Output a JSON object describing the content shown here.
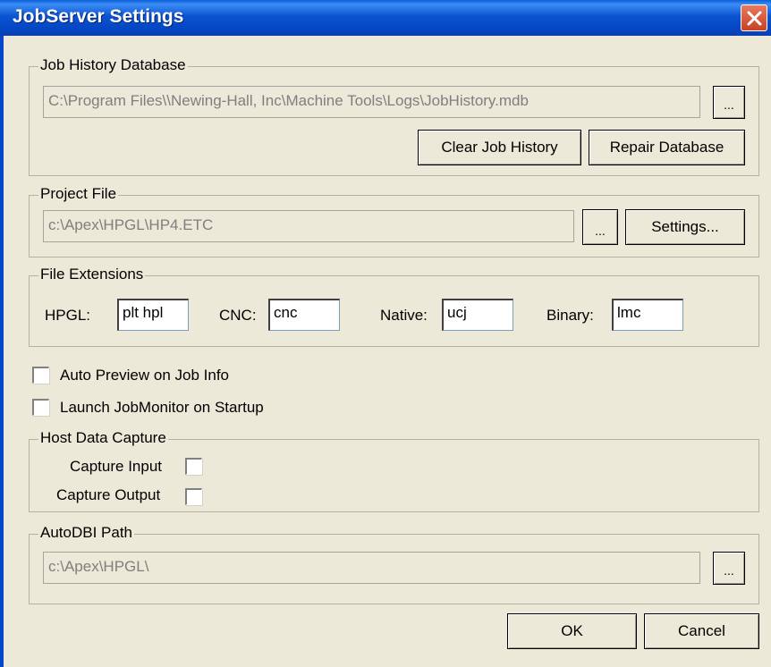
{
  "window": {
    "title": "JobServer Settings"
  },
  "job_history": {
    "group_label": "Job History Database",
    "path": "C:\\Program Files\\\\Newing-Hall, Inc\\Machine Tools\\Logs\\JobHistory.mdb",
    "browse_label": "...",
    "clear_label": "Clear Job History",
    "repair_label": "Repair Database"
  },
  "project_file": {
    "group_label": "Project File",
    "path": "c:\\Apex\\HPGL\\HP4.ETC",
    "browse_label": "...",
    "settings_label": "Settings..."
  },
  "file_extensions": {
    "group_label": "File Extensions",
    "hpgl_label": "HPGL:",
    "hpgl_value": "plt hpl",
    "cnc_label": "CNC:",
    "cnc_value": "cnc",
    "native_label": "Native:",
    "native_value": "ucj",
    "binary_label": "Binary:",
    "binary_value": "lmc"
  },
  "options": {
    "auto_preview_label": "Auto Preview on Job Info",
    "auto_preview_checked": false,
    "launch_monitor_label": "Launch JobMonitor on Startup",
    "launch_monitor_checked": false
  },
  "host_data_capture": {
    "group_label": "Host Data Capture",
    "capture_input_label": "Capture Input",
    "capture_input_checked": false,
    "capture_output_label": "Capture Output",
    "capture_output_checked": false
  },
  "autodbi": {
    "group_label": "AutoDBI Path",
    "path": "c:\\Apex\\HPGL\\",
    "browse_label": "..."
  },
  "footer": {
    "ok_label": "OK",
    "cancel_label": "Cancel"
  },
  "colors": {
    "titlebar": "#0a54d0",
    "face": "#ece9d8",
    "disabled_text": "#7f7f7f"
  }
}
